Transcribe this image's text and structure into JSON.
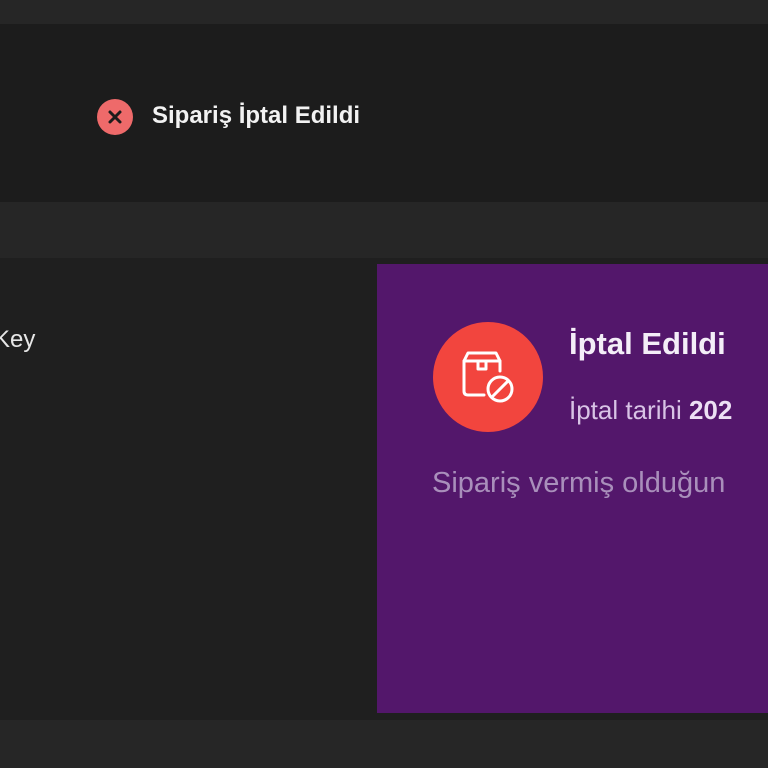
{
  "header": {
    "title": "Sipariş İptal Edildi",
    "status_icon": "close-icon",
    "status_icon_color": "#ee6a6a"
  },
  "left_panel": {
    "label": "Key"
  },
  "status_card": {
    "title": "İptal Edildi",
    "date_label": "İptal tarihi",
    "date_value": "202",
    "message": "Sipariş vermiş olduğun",
    "icon": "package-cancel-icon",
    "icon_color": "#f2453e",
    "background_color": "#53176b"
  }
}
